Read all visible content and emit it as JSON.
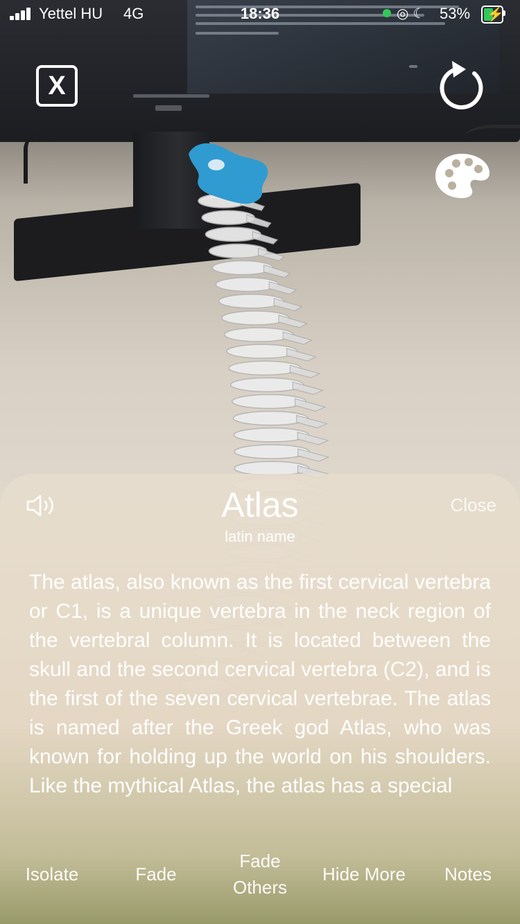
{
  "status_bar": {
    "carrier": "Yettel HU",
    "network": "4G",
    "time": "18:36",
    "battery_percent": "53%",
    "battery_level": 0.53,
    "signal_bars": 4
  },
  "controls": {
    "close_label": "X",
    "reset_icon": "rotate-icon",
    "palette_icon": "palette-icon"
  },
  "model": {
    "highlight_color": "#2f9bd0",
    "bone_color": "#ececec"
  },
  "info_sheet": {
    "title": "Atlas",
    "subtitle": "latin name",
    "close_label": "Close",
    "speaker_icon": "speaker-icon",
    "description": "The atlas, also known as the first cervical vertebra or C1, is a unique vertebra in the neck region of the vertebral column. It is located between the skull and the second cervical vertebra (C2), and is the first of the seven cervical vertebrae. The atlas is named after the Greek god Atlas, who was known for holding up the world on his shoulders. Like the mythical Atlas, the atlas has a special"
  },
  "actions": [
    {
      "label": "Isolate"
    },
    {
      "label": "Fade"
    },
    {
      "label": "Fade Others"
    },
    {
      "label": "Hide More"
    },
    {
      "label": "Notes"
    }
  ]
}
